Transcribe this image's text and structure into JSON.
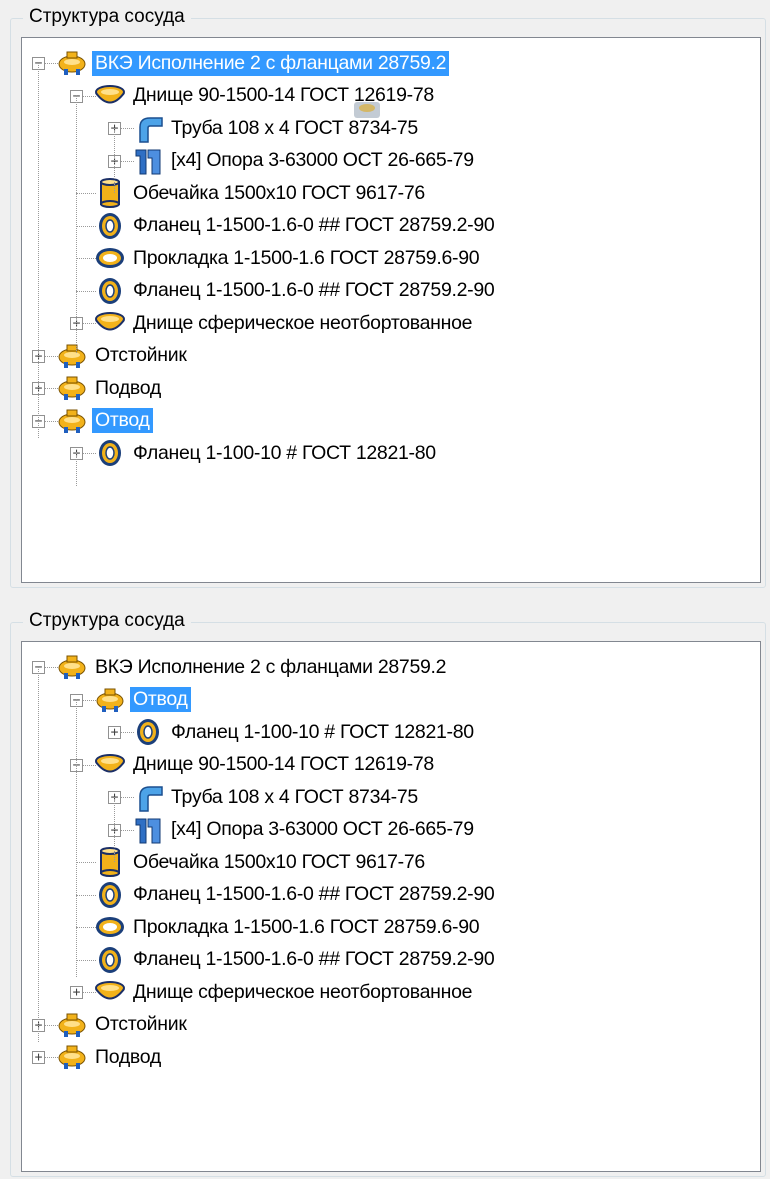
{
  "panel_top": {
    "title": "Структура сосуда",
    "nodes": [
      {
        "label": "ВКЭ Исполнение 2 с фланцами 28759.2",
        "icon": "vessel-icon",
        "selected": true
      },
      {
        "label": "Днище 90-1500-14 ГОСТ 12619-78",
        "icon": "head-icon"
      },
      {
        "label": "Труба 108 x 4 ГОСТ 8734-75",
        "icon": "pipe-icon"
      },
      {
        "label": "[x4] Опора 3-63000 ОСТ 26-665-79",
        "icon": "support-icon"
      },
      {
        "label": "Обечайка 1500x10 ГОСТ 9617-76",
        "icon": "shell-icon"
      },
      {
        "label": "Фланец 1-1500-1.6-0 ## ГОСТ 28759.2-90",
        "icon": "flange-icon"
      },
      {
        "label": "Прокладка 1-1500-1.6 ГОСТ 28759.6-90",
        "icon": "gasket-icon"
      },
      {
        "label": "Фланец 1-1500-1.6-0 ## ГОСТ 28759.2-90",
        "icon": "flange-icon"
      },
      {
        "label": "Днище сферическое неотбортованное",
        "icon": "head-icon"
      },
      {
        "label": "Отстойник",
        "icon": "vessel-icon"
      },
      {
        "label": "Подвод",
        "icon": "vessel-icon"
      },
      {
        "label": "Отвод",
        "icon": "vessel-icon",
        "selected": true
      },
      {
        "label": "Фланец 1-100-10 # ГОСТ 12821-80",
        "icon": "flange-icon"
      }
    ]
  },
  "panel_bottom": {
    "title": "Структура сосуда",
    "nodes": [
      {
        "label": "ВКЭ Исполнение 2 с фланцами 28759.2",
        "icon": "vessel-icon"
      },
      {
        "label": "Отвод",
        "icon": "vessel-icon",
        "selected": true
      },
      {
        "label": "Фланец 1-100-10 # ГОСТ 12821-80",
        "icon": "flange-icon"
      },
      {
        "label": "Днище 90-1500-14 ГОСТ 12619-78",
        "icon": "head-icon"
      },
      {
        "label": "Труба 108 x 4 ГОСТ 8734-75",
        "icon": "pipe-icon"
      },
      {
        "label": "[x4] Опора 3-63000 ОСТ 26-665-79",
        "icon": "support-icon"
      },
      {
        "label": "Обечайка 1500x10 ГОСТ 9617-76",
        "icon": "shell-icon"
      },
      {
        "label": "Фланец 1-1500-1.6-0 ## ГОСТ 28759.2-90",
        "icon": "flange-icon"
      },
      {
        "label": "Прокладка 1-1500-1.6 ГОСТ 28759.6-90",
        "icon": "gasket-icon"
      },
      {
        "label": "Фланец 1-1500-1.6-0 ## ГОСТ 28759.2-90",
        "icon": "flange-icon"
      },
      {
        "label": "Днище сферическое неотбортованное",
        "icon": "head-icon"
      },
      {
        "label": "Отстойник",
        "icon": "vessel-icon"
      },
      {
        "label": "Подвод",
        "icon": "vessel-icon"
      }
    ]
  },
  "colors": {
    "selection": "#3399ff",
    "icon_gold": "#f2b21a",
    "icon_blue": "#1f5fbf"
  }
}
